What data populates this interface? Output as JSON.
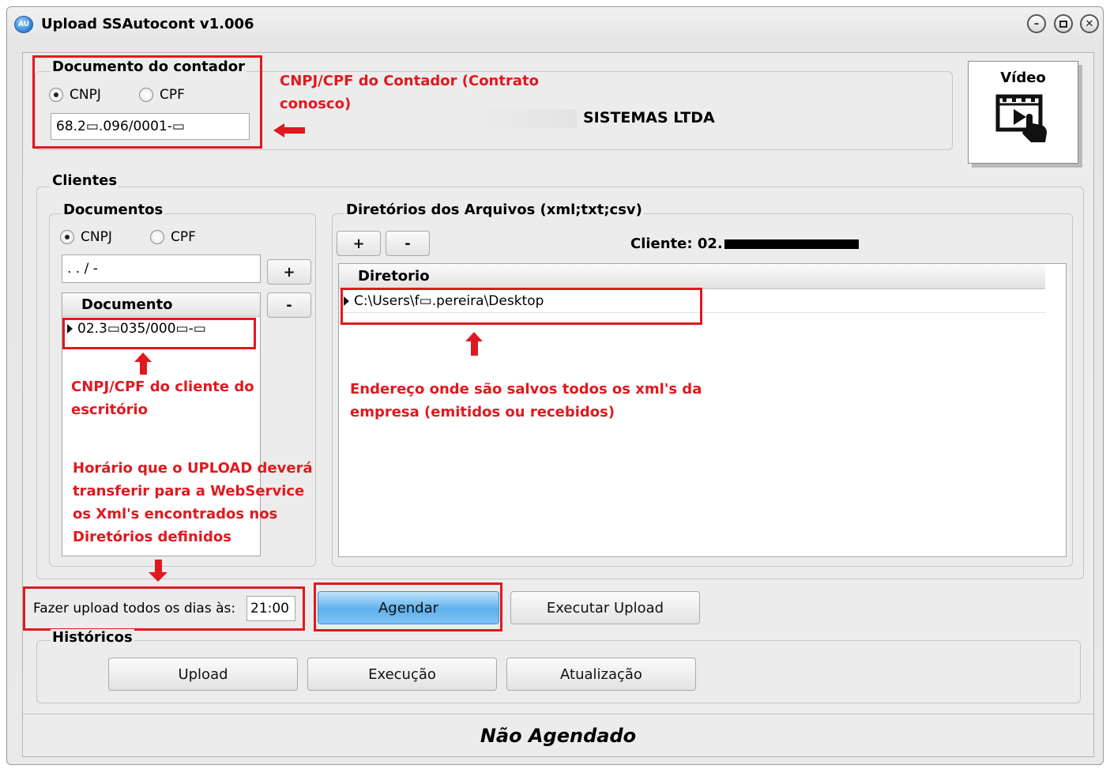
{
  "window": {
    "title": "Upload SSAutocont v1.006",
    "app_icon_text": "AU"
  },
  "contador": {
    "group_label": "Documento do contador",
    "radio_cnpj": "CNPJ",
    "radio_cpf": "CPF",
    "selected": "CNPJ",
    "document_value": "68.2▭.096/0001-▭",
    "company_name": "SISTEMAS LTDA"
  },
  "video": {
    "label": "Vídeo"
  },
  "clientes": {
    "group_label": "Clientes",
    "documentos": {
      "group_label": "Documentos",
      "radio_cnpj": "CNPJ",
      "radio_cpf": "CPF",
      "mask_value": ". . /  -",
      "add_label": "+",
      "remove_label": "-",
      "column_header": "Documento",
      "rows": [
        "02.3▭035/000▭-▭"
      ]
    },
    "diretorios": {
      "group_label": "Diretórios dos Arquivos (xml;txt;csv)",
      "add_label": "+",
      "remove_label": "-",
      "cliente_label": "Cliente: 02.",
      "column_header": "Diretorio",
      "rows": [
        "C:\\Users\\f▭.pereira\\Desktop"
      ]
    }
  },
  "schedule": {
    "label": "Fazer upload todos os dias às:",
    "time": "21:00",
    "agendar_label": "Agendar",
    "executar_label": "Executar Upload"
  },
  "historicos": {
    "group_label": "Históricos",
    "buttons": [
      "Upload",
      "Execução",
      "Atualização"
    ]
  },
  "status": {
    "text": "Não Agendado"
  },
  "annotations": {
    "contador_note": [
      "CNPJ/CPF do Contador (Contrato",
      "conosco)"
    ],
    "cliente_note": [
      "CNPJ/CPF do cliente do",
      "escritório"
    ],
    "diretorio_note": [
      "Endereço onde são salvos todos os xml's da",
      "empresa (emitidos ou recebidos)"
    ],
    "horario_note": [
      "Horário que o UPLOAD deverá",
      "transferir para a WebService",
      "os Xml's encontrados nos",
      "Diretórios definidos"
    ]
  },
  "colors": {
    "annotation_red": "#e0191f",
    "agendar_blue": "#5eb0ec"
  }
}
